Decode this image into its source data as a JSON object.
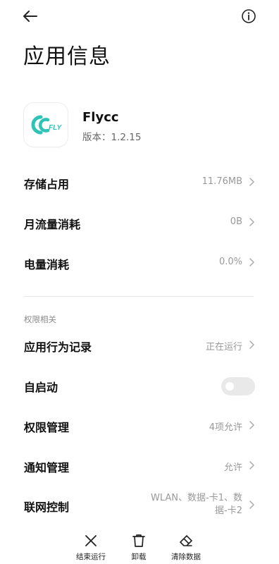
{
  "page": {
    "title": "应用信息"
  },
  "top_bar": {
    "back_icon": "arrow-left-icon",
    "info_icon": "info-circle-icon"
  },
  "app": {
    "name": "Flycc",
    "version": "版本：1.2.15",
    "icon_text": "FLY",
    "icon_color": "#2ec3b7"
  },
  "rows_top": [
    {
      "label": "存储占用",
      "value": "11.76MB"
    },
    {
      "label": "月流量消耗",
      "value": "0B"
    },
    {
      "label": "电量消耗",
      "value": "0.0%"
    }
  ],
  "permissions": {
    "section_label": "权限相关",
    "behavior": {
      "label": "应用行为记录",
      "value": "正在运行"
    },
    "autostart": {
      "label": "自启动",
      "enabled": false
    },
    "perm_manage": {
      "label": "权限管理",
      "value": "4项允许"
    },
    "notif_manage": {
      "label": "通知管理",
      "value": "允许"
    },
    "network": {
      "label": "联网控制",
      "value_line1": "WLAN、数据-卡1、数",
      "value_line2": "据-卡2"
    }
  },
  "bottom_bar": [
    {
      "label": "结束运行",
      "icon": "close-x-icon"
    },
    {
      "label": "卸载",
      "icon": "trash-icon"
    },
    {
      "label": "清除数据",
      "icon": "eraser-icon"
    }
  ]
}
